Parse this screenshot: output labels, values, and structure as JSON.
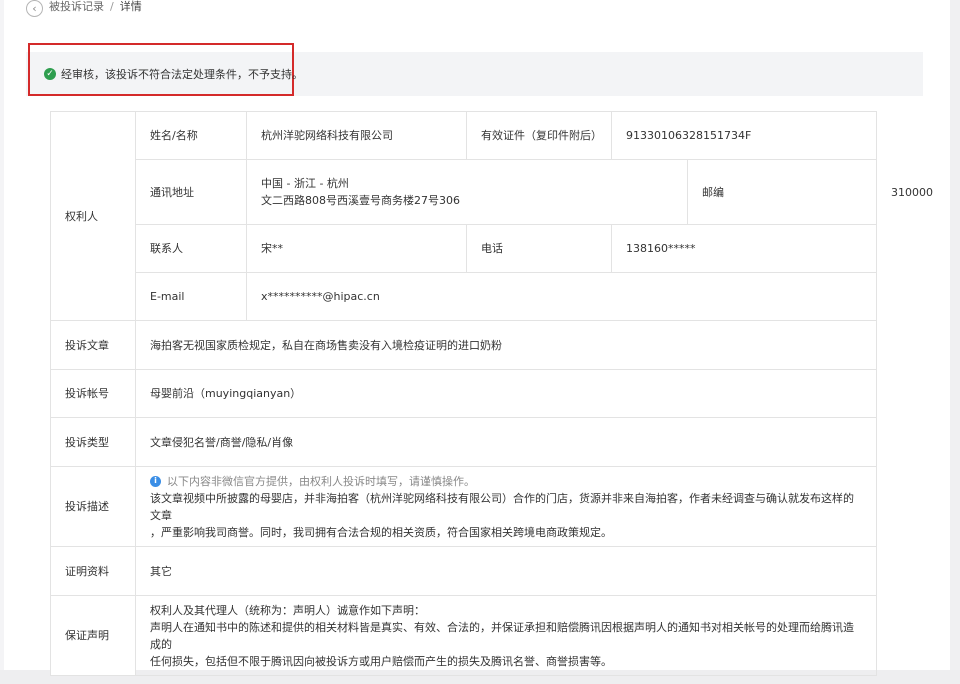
{
  "breadcrumb": {
    "back_icon": "chevron-left-icon",
    "parent": "被投诉记录",
    "separator": "/",
    "current": "详情"
  },
  "notice": {
    "icon": "check-circle-icon",
    "text": "经审核，该投诉不符合法定处理条件，不予支持。",
    "colors": {
      "check": "#2e9e4f",
      "highlight_border": "#d42a2a"
    }
  },
  "rights_holder": {
    "section_label": "权利人",
    "name_label": "姓名/名称",
    "name_value": "杭州洋驼网络科技有限公司",
    "cert_label": "有效证件（复印件附后）",
    "cert_value": "91330106328151734F",
    "address_label": "通讯地址",
    "address_line1": "中国 - 浙江 - 杭州",
    "address_line2": "文二西路808号西溪壹号商务楼27号306",
    "postcode_label": "邮编",
    "postcode_value": "310000",
    "contact_label": "联系人",
    "contact_value": "宋**",
    "phone_label": "电话",
    "phone_value": "138160*****",
    "email_label": "E-mail",
    "email_value": "x**********@hipac.cn"
  },
  "rows": {
    "article_label": "投诉文章",
    "article_value": "海拍客无视国家质检规定，私自在商场售卖没有入境检疫证明的进口奶粉",
    "account_label": "投诉帐号",
    "account_value": "母婴前沿（muyingqianyan）",
    "type_label": "投诉类型",
    "type_value": "文章侵犯名誉/商誉/隐私/肖像",
    "desc_label": "投诉描述",
    "desc_note": "以下内容非微信官方提供，由权利人投诉时填写，请谨慎操作。",
    "desc_icon": "info-icon",
    "desc_line1": "该文章视频中所披露的母婴店，并非海拍客（杭州洋驼网络科技有限公司）合作的门店，货源并非来自海拍客，作者未经调查与确认就发布这样的文章",
    "desc_line2": "，严重影响我司商誉。同时，我司拥有合法合规的相关资质，符合国家相关跨境电商政策规定。",
    "proof_label": "证明资料",
    "proof_value": "其它",
    "guarantee_label": "保证声明",
    "guarantee_line1": "权利人及其代理人（统称为：声明人）诚意作如下声明：",
    "guarantee_line2": "声明人在通知书中的陈述和提供的相关材料皆是真实、有效、合法的，并保证承担和赔偿腾讯因根据声明人的通知书对相关帐号的处理而给腾讯造成的",
    "guarantee_line3": "任何损失，包括但不限于腾讯因向被投诉方或用户赔偿而产生的损失及腾讯名誉、商誉损害等。"
  }
}
